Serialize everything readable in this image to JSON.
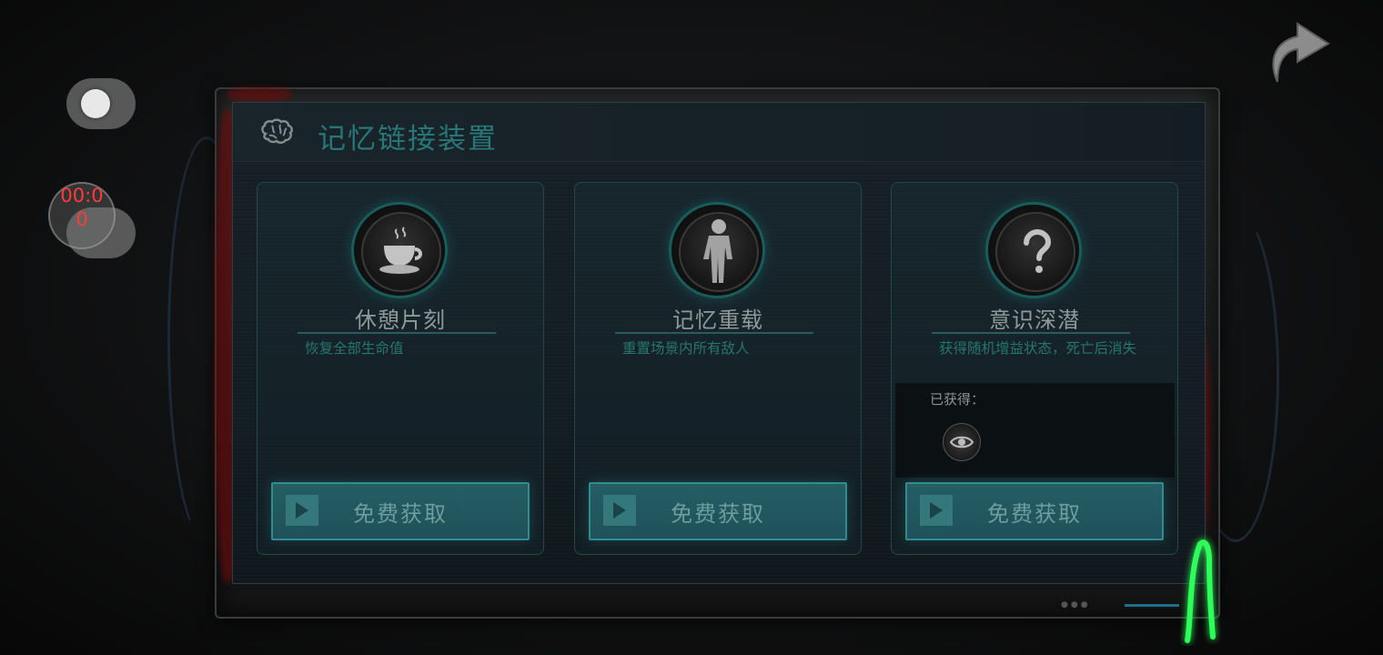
{
  "panel": {
    "title": "记忆链接装置",
    "icon": "brain-icon"
  },
  "cards": [
    {
      "name": "休憩片刻",
      "description": "恢复全部生命值",
      "icon": "coffee-cup-icon",
      "button_label": "免费获取"
    },
    {
      "name": "记忆重载",
      "description": "重置场景内所有敌人",
      "icon": "astronaut-figure-icon",
      "button_label": "免费获取"
    },
    {
      "name": "意识深潜",
      "description": "获得随机增益状态，死亡后消失",
      "icon": "question-mark-icon",
      "button_label": "免费获取",
      "obtained_label": "已获得：",
      "obtained_items": [
        "eye-buff-icon"
      ]
    }
  ],
  "overlay": {
    "timer_line1": "00:0",
    "timer_line2": "0"
  },
  "colors": {
    "accent_teal": "#2f8c8e",
    "button_fill": "#2c6f77",
    "timer_red": "#ff3b3b",
    "signal_green": "#2dff5a"
  }
}
